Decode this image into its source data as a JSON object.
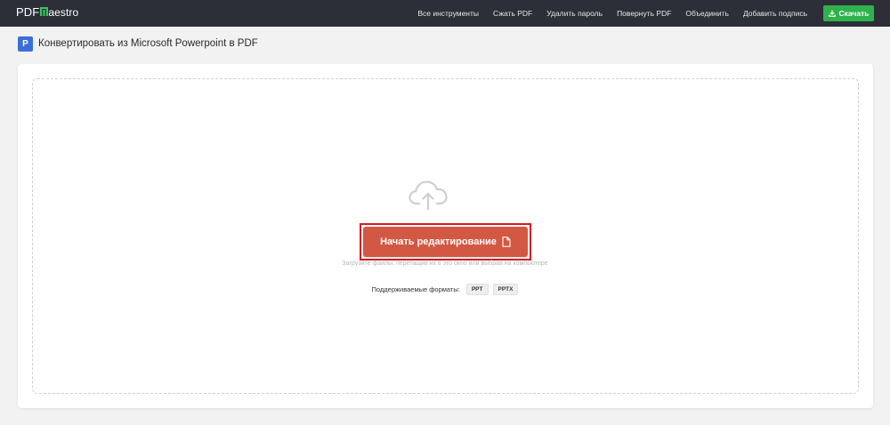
{
  "header": {
    "logo": {
      "prefix": "PDF",
      "suffix": "aestro"
    },
    "nav": [
      {
        "label": "Все инструменты"
      },
      {
        "label": "Сжать PDF"
      },
      {
        "label": "Удалить пароль"
      },
      {
        "label": "Повернуть PDF"
      },
      {
        "label": "Объединить"
      },
      {
        "label": "Добавить подпись"
      }
    ],
    "download_label": "Скачать"
  },
  "page": {
    "badge": "P",
    "title": "Конвертировать из Microsoft Powerpoint в PDF"
  },
  "upload": {
    "cta_label": "Начать редактирование",
    "hint": "Загрузите файлы, перетащив их в это окно или выбрав на компьютере",
    "formats_label": "Поддерживаемые форматы:",
    "formats": [
      "PPT",
      "PPTX"
    ]
  },
  "colors": {
    "topbar": "#2c2f38",
    "accent_green": "#2fb24c",
    "cta": "#d35843",
    "highlight": "#d71921",
    "ppt_blue": "#3a6fd8"
  },
  "icons": {
    "cloud": "cloud-upload-icon",
    "file": "file-icon",
    "download": "download-icon"
  }
}
